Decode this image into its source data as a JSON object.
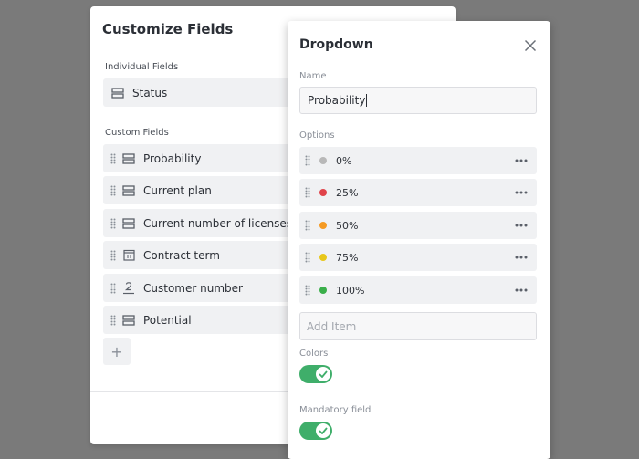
{
  "left_panel": {
    "title": "Customize Fields",
    "individual_label": "Individual Fields",
    "individual_fields": [
      {
        "label": "Status",
        "icon": "list-icon"
      }
    ],
    "custom_label": "Custom Fields",
    "custom_fields": [
      {
        "label": "Probability",
        "icon": "list-icon"
      },
      {
        "label": "Current plan",
        "icon": "list-icon"
      },
      {
        "label": "Current number of licenses",
        "icon": "list-icon"
      },
      {
        "label": "Contract term",
        "icon": "calendar-icon"
      },
      {
        "label": "Customer number",
        "icon": "number-icon"
      },
      {
        "label": "Potential",
        "icon": "list-icon"
      }
    ],
    "add_label": "+"
  },
  "dropdown_panel": {
    "title": "Dropdown",
    "name_label": "Name",
    "name_value": "Probability",
    "options_label": "Options",
    "options": [
      {
        "label": "0%",
        "color": "#b8b8b8"
      },
      {
        "label": "25%",
        "color": "#e0434a"
      },
      {
        "label": "50%",
        "color": "#f59a23"
      },
      {
        "label": "75%",
        "color": "#e8c71a"
      },
      {
        "label": "100%",
        "color": "#3aaf4a"
      }
    ],
    "add_item_placeholder": "Add Item",
    "colors_label": "Colors",
    "colors_enabled": true,
    "mandatory_label": "Mandatory field",
    "mandatory_enabled": true,
    "toggle_color": "#3fae6a"
  }
}
